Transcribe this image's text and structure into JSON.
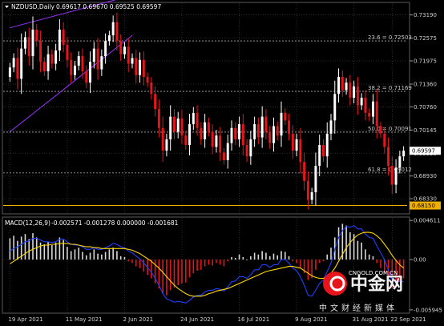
{
  "chart_header": {
    "symbol_label": "NZDUSD,Daily",
    "ohlc_text": "0.69617 0.69670 0.69525 0.69597"
  },
  "macd_header": {
    "label": "MACD(12,26,9)",
    "values_text": "-0.002571 -0.001278 0.000000 -0.001681"
  },
  "watermark": {
    "brand": "中金网",
    "url": "CNGOLD.COM.CN",
    "slogan": "中文财经新媒体"
  },
  "colors": {
    "background": "#000000",
    "up_candle": "#ffffff",
    "down_candle": "#e8141c",
    "grid": "#3a3a3a",
    "trendline": "#9933ff",
    "fib_line": "#b0b0b0",
    "support_line": "#f0b000",
    "signal_line": "#ffd700",
    "macd_line": "#2040ff",
    "hist_pos": "#d8d8d8",
    "hist_neg": "#e8141c"
  },
  "chart_data": [
    {
      "type": "candlestick",
      "symbol": "NZDUSD",
      "timeframe": "Daily",
      "x_tick_labels": [
        "19 Apr 2021",
        "11 May 2021",
        "2 Jun 2021",
        "24 Jun 2021",
        "16 Jul 2021",
        "9 Aug 2021",
        "31 Aug 2021",
        "22 Sep 2021"
      ],
      "y_tick_labels": [
        "0.73190",
        "0.72575",
        "0.71975",
        "0.71360",
        "0.70760",
        "0.70145",
        "0.69530",
        "0.68930",
        "0.68330"
      ],
      "ylim": [
        0.6795,
        0.735
      ],
      "current_price": "0.69597",
      "current_price_value": 0.69597,
      "support_level": "0.68150",
      "support_value": 0.6815,
      "fib_levels": [
        {
          "label": "23.6 = 0.72503",
          "value": 0.72503
        },
        {
          "label": "38.2 = 0.71169",
          "value": 0.71169
        },
        {
          "label": "50.0 = 0.70091",
          "value": 0.70091
        },
        {
          "label": "61.8 = 0.69012",
          "value": 0.69012
        }
      ],
      "trendlines": [
        {
          "from": [
            0,
            0.7285
          ],
          "to": [
            28,
            0.736
          ]
        },
        {
          "from": [
            0,
            0.701
          ],
          "to": [
            32,
            0.7265
          ]
        }
      ],
      "closes": [
        0.718,
        0.7205,
        0.715,
        0.723,
        0.726,
        0.721,
        0.728,
        0.725,
        0.7195,
        0.717,
        0.7215,
        0.719,
        0.7225,
        0.728,
        0.724,
        0.72,
        0.716,
        0.7185,
        0.721,
        0.717,
        0.714,
        0.7195,
        0.723,
        0.7175,
        0.721,
        0.725,
        0.7265,
        0.73,
        0.725,
        0.7215,
        0.7235,
        0.719,
        0.7205,
        0.716,
        0.72,
        0.7155,
        0.714,
        0.711,
        0.707,
        0.702,
        0.696,
        0.699,
        0.705,
        0.701,
        0.7045,
        0.7,
        0.6975,
        0.703,
        0.706,
        0.702,
        0.699,
        0.7035,
        0.701,
        0.697,
        0.7,
        0.6955,
        0.6935,
        0.698,
        0.702,
        0.699,
        0.703,
        0.6975,
        0.6945,
        0.699,
        0.703,
        0.6995,
        0.705,
        0.701,
        0.698,
        0.7025,
        0.7,
        0.706,
        0.704,
        0.7005,
        0.696,
        0.699,
        0.693,
        0.688,
        0.683,
        0.685,
        0.692,
        0.6975,
        0.6945,
        0.7005,
        0.704,
        0.711,
        0.7155,
        0.712,
        0.714,
        0.71,
        0.713,
        0.708,
        0.71,
        0.706,
        0.705,
        0.709,
        0.7025,
        0.7005,
        0.697,
        0.692,
        0.687,
        0.6915,
        0.6945,
        0.696
      ],
      "macd_ylim": [
        -0.0062,
        0.0049
      ],
      "macd_tick_labels": [
        "0.004611",
        "0.00",
        "-0.005945"
      ],
      "macd_values": {
        "histogram": [
          0.0025,
          0.0028,
          0.0022,
          0.0027,
          0.003,
          0.0024,
          0.0031,
          0.0026,
          0.002,
          0.0018,
          0.0021,
          0.0017,
          0.002,
          0.0026,
          0.0023,
          0.0015,
          0.001,
          0.0012,
          0.0014,
          0.0009,
          0.0005,
          0.0008,
          0.0012,
          0.0007,
          0.0006,
          0.0009,
          0.0012,
          0.0014,
          0.001,
          0.0004,
          0.0003,
          -0.0002,
          -0.0004,
          -0.0008,
          -0.001,
          -0.0014,
          -0.0018,
          -0.0022,
          -0.0028,
          -0.0034,
          -0.004,
          -0.0042,
          -0.0036,
          -0.0033,
          -0.003,
          -0.0028,
          -0.0027,
          -0.0021,
          -0.0016,
          -0.0013,
          -0.0012,
          -0.0008,
          -0.0006,
          -0.0007,
          -0.0004,
          -0.0006,
          -0.0008,
          -0.0002,
          0.0003,
          0.0002,
          0.0006,
          0.0003,
          0.0,
          0.0004,
          0.0008,
          0.0006,
          0.001,
          0.0008,
          0.0004,
          0.0007,
          0.0005,
          0.001,
          0.0009,
          0.0004,
          -0.0002,
          -0.0004,
          -0.001,
          -0.0016,
          -0.0024,
          -0.0022,
          -0.0012,
          -0.0004,
          -0.0002,
          0.0006,
          0.0014,
          0.0026,
          0.0038,
          0.0042,
          0.004,
          0.0032,
          0.003,
          0.0022,
          0.002,
          0.0012,
          0.0006,
          0.0004,
          -0.0004,
          -0.001,
          -0.0016,
          -0.0026,
          -0.0034,
          -0.003,
          -0.0026,
          -0.0022
        ],
        "macd_line": [
          0.001,
          0.0013,
          0.0015,
          0.0018,
          0.0021,
          0.0022,
          0.0025,
          0.0025,
          0.0023,
          0.0021,
          0.0021,
          0.002,
          0.0021,
          0.0024,
          0.0024,
          0.0021,
          0.0018,
          0.0017,
          0.0017,
          0.0015,
          0.0012,
          0.0012,
          0.0014,
          0.0012,
          0.0012,
          0.0014,
          0.0016,
          0.0019,
          0.0018,
          0.0015,
          0.0014,
          0.001,
          0.0008,
          0.0004,
          0.0001,
          -0.0004,
          -0.0009,
          -0.0015,
          -0.0022,
          -0.003,
          -0.004,
          -0.0046,
          -0.0048,
          -0.005,
          -0.0049,
          -0.005,
          -0.0051,
          -0.0048,
          -0.0044,
          -0.0042,
          -0.0042,
          -0.0038,
          -0.0036,
          -0.0036,
          -0.0034,
          -0.0035,
          -0.0037,
          -0.0032,
          -0.0026,
          -0.0025,
          -0.002,
          -0.002,
          -0.0022,
          -0.0018,
          -0.0012,
          -0.0012,
          -0.0006,
          -0.0006,
          -0.0009,
          -0.0006,
          -0.0006,
          0.0,
          0.0,
          -0.0004,
          -0.001,
          -0.0013,
          -0.002,
          -0.003,
          -0.0042,
          -0.0043,
          -0.0036,
          -0.0028,
          -0.0024,
          -0.0014,
          -0.0004,
          0.0012,
          0.0026,
          0.0034,
          0.0039,
          0.0038,
          0.004,
          0.0036,
          0.0036,
          0.003,
          0.0026,
          0.0025,
          0.0016,
          0.0008,
          0.0,
          -0.0012,
          -0.0024,
          -0.0025,
          -0.0026,
          -0.0026
        ],
        "signal_line": [
          -0.0005,
          -0.0002,
          0.0001,
          0.0004,
          0.0007,
          0.001,
          0.0012,
          0.0014,
          0.0016,
          0.0017,
          0.0017,
          0.0018,
          0.0018,
          0.0019,
          0.0019,
          0.0019,
          0.0018,
          0.0018,
          0.0017,
          0.0016,
          0.0015,
          0.0015,
          0.0014,
          0.0014,
          0.0013,
          0.0013,
          0.0013,
          0.0013,
          0.0013,
          0.0013,
          0.0013,
          0.0012,
          0.0011,
          0.0009,
          0.0007,
          0.0004,
          0.0001,
          -0.0002,
          -0.0006,
          -0.001,
          -0.0015,
          -0.002,
          -0.0025,
          -0.003,
          -0.0034,
          -0.0037,
          -0.004,
          -0.0042,
          -0.0043,
          -0.0043,
          -0.0043,
          -0.0042,
          -0.004,
          -0.0039,
          -0.0037,
          -0.0036,
          -0.0035,
          -0.0034,
          -0.0032,
          -0.003,
          -0.0028,
          -0.0026,
          -0.0024,
          -0.0022,
          -0.002,
          -0.0018,
          -0.0016,
          -0.0014,
          -0.0013,
          -0.0012,
          -0.0011,
          -0.001,
          -0.0009,
          -0.0008,
          -0.0008,
          -0.0009,
          -0.001,
          -0.0013,
          -0.0016,
          -0.0019,
          -0.0021,
          -0.0022,
          -0.0022,
          -0.002,
          -0.0016,
          -0.001,
          -0.0002,
          0.0006,
          0.0014,
          0.002,
          0.0025,
          0.0029,
          0.0031,
          0.0032,
          0.0032,
          0.0031,
          0.0028,
          0.0024,
          0.0018,
          0.0012,
          0.0005,
          -0.0001,
          -0.0006,
          -0.001
        ]
      }
    }
  ]
}
